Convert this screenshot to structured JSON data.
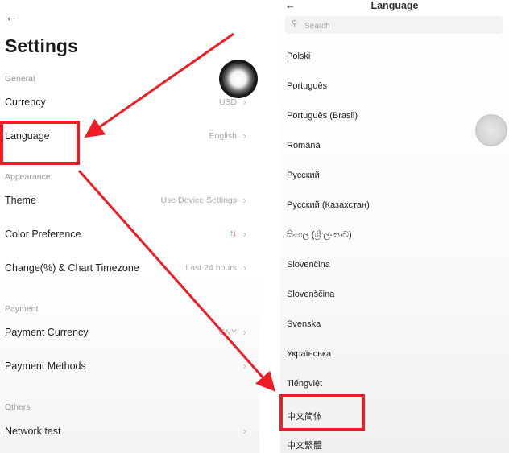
{
  "settings": {
    "title": "Settings",
    "sections": [
      {
        "label": "General",
        "rows": [
          {
            "label": "Currency",
            "value": "USD"
          },
          {
            "label": "Language",
            "value": "English"
          }
        ]
      },
      {
        "label": "Appearance",
        "rows": [
          {
            "label": "Theme",
            "value": "Use Device Settings"
          },
          {
            "label": "Color Preference",
            "value": ""
          },
          {
            "label": "Change(%) & Chart Timezone",
            "value": "Last 24 hours"
          }
        ]
      },
      {
        "label": "Payment",
        "rows": [
          {
            "label": "Payment Currency",
            "value": "CNY"
          },
          {
            "label": "Payment Methods",
            "value": ""
          }
        ]
      },
      {
        "label": "Others",
        "rows": [
          {
            "label": "Network test",
            "value": ""
          }
        ]
      }
    ]
  },
  "language_screen": {
    "title": "Language",
    "search": {
      "placeholder": "Search",
      "value": ""
    },
    "items": [
      "Polski",
      "Português",
      "Português (Brasil)",
      "Română",
      "Русский",
      "Русский (Казахстан)",
      "සිංහල (ශ්‍රී ලංකාව)",
      "Slovenčina",
      "Slovenščina",
      "Svenska",
      "Українська",
      "Tiếngviệt",
      "中文简体",
      "中文繁體"
    ]
  },
  "icons": {
    "back": "arrow-left-icon",
    "chevron": "chevron-right-icon",
    "search": "search-icon",
    "color_preference": "up-down-arrows-icon"
  },
  "colors": {
    "annotation_red": "#ee1c24",
    "up_green": "#2eb88a",
    "down_red": "#e24d4d"
  }
}
